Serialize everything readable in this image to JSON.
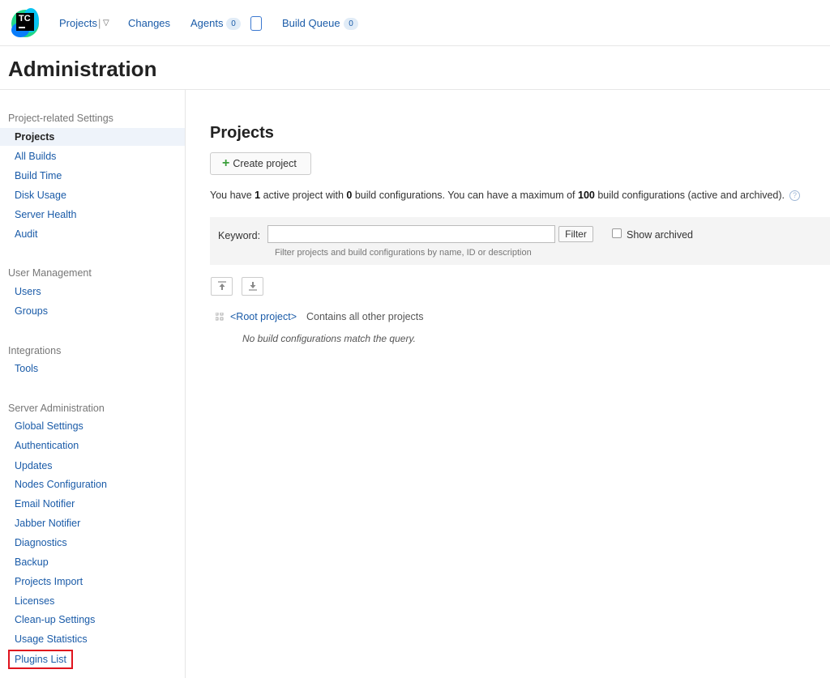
{
  "logo": {
    "text": "TC"
  },
  "topnav": {
    "projects": "Projects",
    "separator": "|",
    "projects_caret": "▽",
    "changes": "Changes",
    "agents": "Agents",
    "agents_count": "0",
    "build_queue": "Build Queue",
    "build_queue_count": "0"
  },
  "page": {
    "title": "Administration"
  },
  "sidebar": {
    "groups": [
      {
        "title": "Project-related Settings",
        "items": [
          "Projects",
          "All Builds",
          "Build Time",
          "Disk Usage",
          "Server Health",
          "Audit"
        ]
      },
      {
        "title": "User Management",
        "items": [
          "Users",
          "Groups"
        ]
      },
      {
        "title": "Integrations",
        "items": [
          "Tools"
        ]
      },
      {
        "title": "Server Administration",
        "items": [
          "Global Settings",
          "Authentication",
          "Updates",
          "Nodes Configuration",
          "Email Notifier",
          "Jabber Notifier",
          "Diagnostics",
          "Backup",
          "Projects Import",
          "Licenses",
          "Clean-up Settings",
          "Usage Statistics",
          "Plugins List"
        ]
      }
    ],
    "active_item": "Projects",
    "highlighted_item": "Plugins List"
  },
  "main": {
    "title": "Projects",
    "create_button": "Create project",
    "info": {
      "p1": "You have ",
      "active_count": "1",
      "p2": " active project with ",
      "config_count": "0",
      "p3": " build configurations. You can have a maximum of ",
      "max_count": "100",
      "p4": " build configurations (active and archived)."
    },
    "filter": {
      "keyword_label": "Keyword:",
      "keyword_value": "",
      "filter_button": "Filter",
      "show_archived": "Show archived",
      "show_archived_checked": false,
      "hint": "Filter projects and build configurations by name, ID or description"
    },
    "tree": {
      "root_link": "<Root project>",
      "root_desc": "Contains all other projects",
      "empty_message": "No build configurations match the query."
    }
  },
  "colors": {
    "link": "#1a5ba8",
    "highlight": "#e0141e",
    "active_bg": "#eef3fa"
  }
}
